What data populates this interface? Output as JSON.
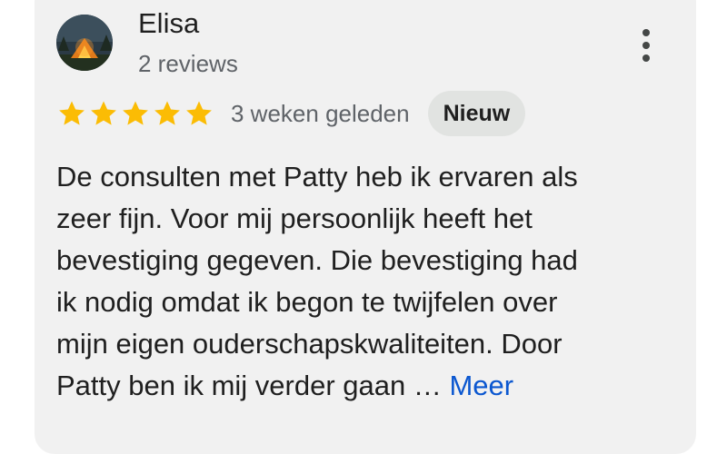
{
  "review": {
    "author": {
      "name": "Elisa",
      "meta": "2 reviews",
      "avatar_icon": "campfire-tent-avatar-icon"
    },
    "more_options_icon": "more-vert-icon",
    "rating": {
      "stars": 5,
      "max_stars": 5,
      "star_color": "#fbbc04"
    },
    "date": "3 weken geleden",
    "badge": "Nieuw",
    "text_lines": [
      "De consulten met Patty heb ik ervaren als",
      "zeer fijn. Voor mij persoonlijk heeft het",
      "bevestiging gegeven. Die bevestiging had",
      "ik nodig omdat ik begon te twijfelen over",
      "mijn eigen ouderschapskwaliteiten. Door",
      "Patty ben ik mij verder gaan …"
    ],
    "more_link": "Meer",
    "colors": {
      "card_background": "#f1f1f1",
      "link": "#0b57d0",
      "badge_background": "#e1e3e1"
    }
  }
}
